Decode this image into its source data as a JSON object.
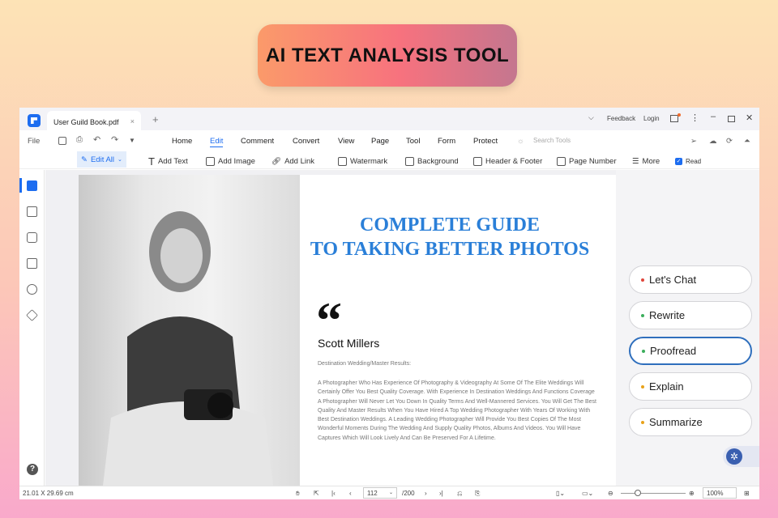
{
  "banner": {
    "title": "AI TEXT ANALYSIS TOOL"
  },
  "tab": {
    "title": "User Guild Book.pdf",
    "close": "×",
    "new": "+"
  },
  "titlebar": {
    "feedback": "Feedback",
    "login": "Login"
  },
  "menu": {
    "file": "File",
    "items": [
      "Home",
      "Edit",
      "Comment",
      "Convert",
      "View",
      "Page",
      "Tool",
      "Form",
      "Protect"
    ],
    "active": "Edit",
    "search_placeholder": "Search Tools"
  },
  "edit_toolbar": {
    "edit_all": "Edit All",
    "items": [
      "Add Text",
      "Add Image",
      "Add Link",
      "Watermark",
      "Background",
      "Header & Footer",
      "Page Number",
      "More"
    ],
    "read": "Read"
  },
  "document": {
    "title_line1": "COMPLETE GUIDE",
    "title_line2": "TO TAKING BETTER PHOTOS",
    "quote": "“",
    "author": "Scott Millers",
    "subtitle": "Destination Wedding/Master Results:",
    "body": "A Photographer Who Has Experience Of Photography & Videography At Some Of The Elite Weddings Will Certainly Offer You Best Quality Coverage. With Experience In Destination Weddings And Functions Coverage A Photographer Will Never Let You Down In Quality Terms And Well-Mannered Services. You Will Get The Best Quality And Master Results When You Have Hired A Top Wedding Photographer With Years Of Working With Best Destination Weddings. A Leading Wedding Photographer Will Provide You Best Copies Of The Most Wonderful Moments During The Wedding And Supply Quality Photos, Albums And Videos. You Will Have Captures Which Will Look Lively And Can Be Preserved For A Lifetime."
  },
  "ai_panel": {
    "actions": [
      {
        "label": "Let's Chat",
        "color": "#e0453a"
      },
      {
        "label": "Rewrite",
        "color": "#3cae5c"
      },
      {
        "label": "Proofread",
        "color": "#3cae5c"
      },
      {
        "label": "Explain",
        "color": "#e8a21a"
      },
      {
        "label": "Summarize",
        "color": "#e8a21a"
      }
    ],
    "selected": "Proofread"
  },
  "status": {
    "dimensions": "21.01 X 29.69 cm",
    "page": "112",
    "total": "/200",
    "zoom": "100%"
  },
  "colors": {
    "accent": "#1d6df0",
    "title_blue": "#2a7fd8"
  }
}
